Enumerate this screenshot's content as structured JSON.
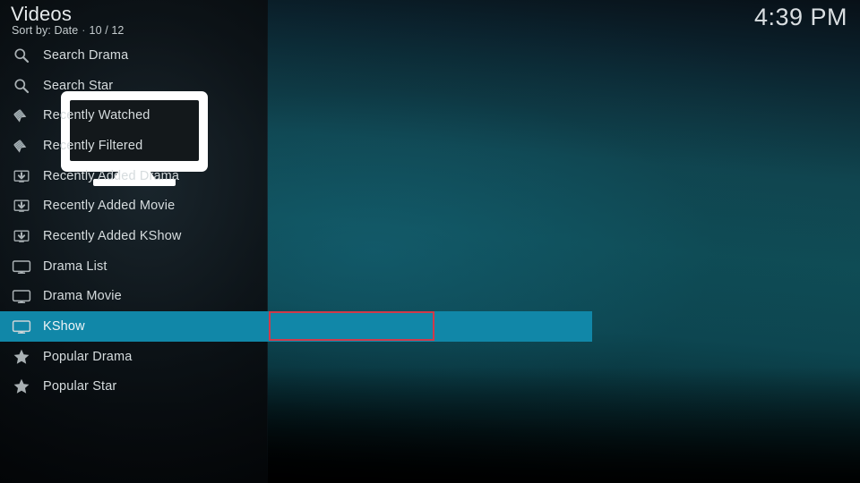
{
  "window": {
    "title": "Videos",
    "sort_label": "Sort by: Date",
    "separator": "·",
    "item_count": "10 / 12",
    "clock": "4:39 PM"
  },
  "colors": {
    "highlight": "#1187a8",
    "annotation": "#d03a4a",
    "text": "#d6dcde",
    "panel_left": "#0b1013",
    "panel_right": "#0f4c55"
  },
  "artwork": {
    "name": "tv-monitor-icon",
    "color": "#ffffff"
  },
  "menu": {
    "selected_index": 9,
    "items": [
      {
        "label": "Search Drama",
        "icon": "search-icon",
        "selected": false
      },
      {
        "label": "Search Star",
        "icon": "search-icon",
        "selected": false
      },
      {
        "label": "Recently Watched",
        "icon": "tag-icon",
        "selected": false
      },
      {
        "label": "Recently Filtered",
        "icon": "tag-icon",
        "selected": false
      },
      {
        "label": "Recently Added Drama",
        "icon": "download-icon",
        "selected": false
      },
      {
        "label": "Recently Added Movie",
        "icon": "download-icon",
        "selected": false
      },
      {
        "label": "Recently Added KShow",
        "icon": "download-icon",
        "selected": false
      },
      {
        "label": "Drama List",
        "icon": "monitor-icon",
        "selected": false
      },
      {
        "label": "Drama Movie",
        "icon": "monitor-icon",
        "selected": false
      },
      {
        "label": "KShow",
        "icon": "monitor-icon",
        "selected": true
      },
      {
        "label": "Popular Drama",
        "icon": "star-icon",
        "selected": false
      },
      {
        "label": "Popular Star",
        "icon": "star-icon",
        "selected": false
      }
    ]
  }
}
